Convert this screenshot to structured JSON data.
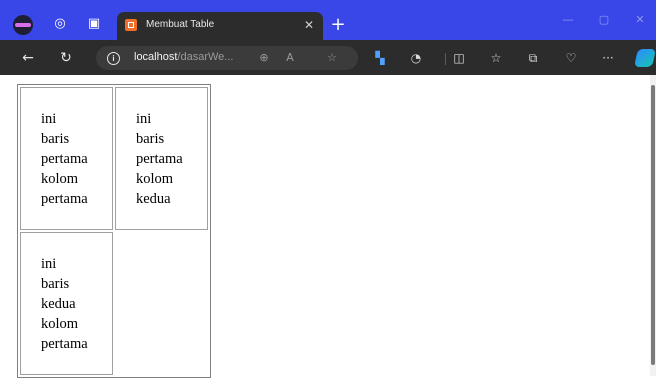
{
  "browser": {
    "tab": {
      "title": "Membuat Table"
    },
    "address_bar": {
      "host": "localhost",
      "path": "/dasarWe..."
    }
  },
  "page": {
    "table": {
      "rows": [
        [
          "ini baris pertama kolom pertama",
          "ini baris pertama kolom kedua"
        ],
        [
          "ini baris kedua kolom pertama"
        ]
      ]
    }
  },
  "colors": {
    "titlebar_bg": "#3a47e8",
    "toolbar_bg": "#2c2c2c",
    "tab_favicon": "#f06e2a"
  },
  "icons": {
    "titlebar": [
      "profile-icon",
      "workspaces-icon",
      "tab-actions-icon"
    ],
    "tab": [
      "favicon-icon",
      "close-icon"
    ],
    "toolbar": [
      "back-icon",
      "refresh-icon",
      "site-info-icon",
      "zoom-icon",
      "read-aloud-icon",
      "favorite-star-icon",
      "extension-icon",
      "performance-icon",
      "split-screen-icon",
      "favorites-icon",
      "collections-icon",
      "browser-essentials-icon",
      "more-icon",
      "copilot-icon"
    ],
    "window": [
      "minimize-icon",
      "maximize-icon",
      "close-window-icon"
    ]
  }
}
